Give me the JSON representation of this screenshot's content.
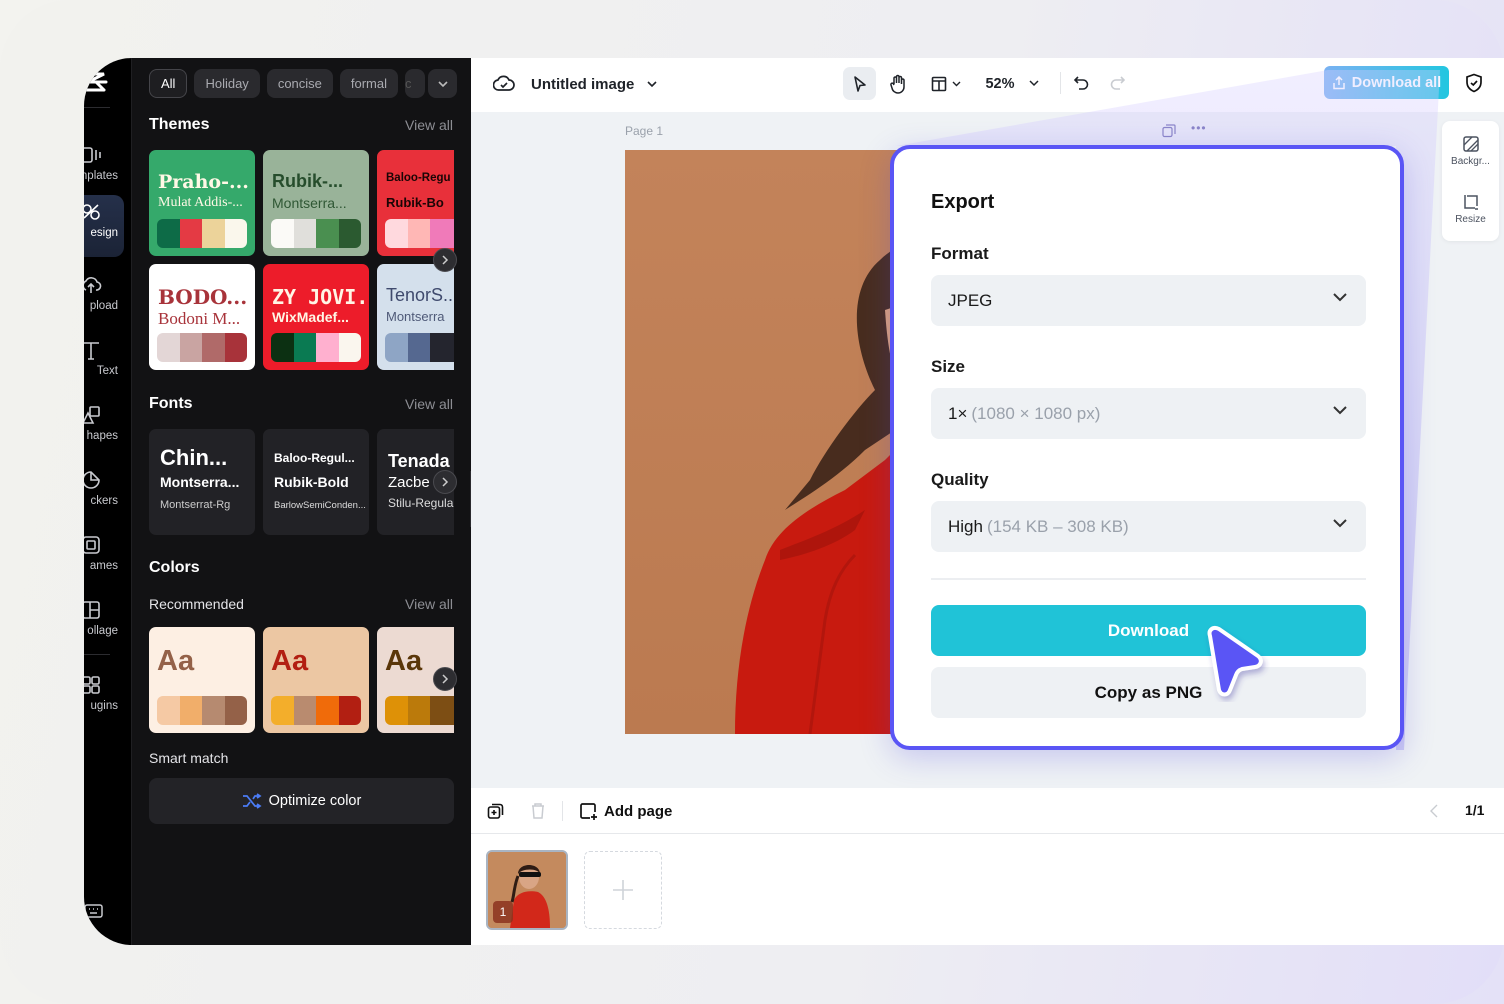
{
  "colors": {
    "accent": "#5a55f5",
    "download_button": "#20c3d7",
    "download_all_gradient": [
      "#7ab1f2",
      "#22c6e0"
    ],
    "panel_bg": "#121214"
  },
  "rail": {
    "items": [
      {
        "label": "Templates",
        "visible_label": "nplates",
        "icon": "templates-icon"
      },
      {
        "label": "Design",
        "visible_label": "esign",
        "icon": "design-icon",
        "active": true
      },
      {
        "label": "Upload",
        "visible_label": "pload",
        "icon": "upload-icon"
      },
      {
        "label": "Text",
        "visible_label": "Text",
        "icon": "text-icon"
      },
      {
        "label": "Shapes",
        "visible_label": "hapes",
        "icon": "shapes-icon"
      },
      {
        "label": "Stickers",
        "visible_label": "ckers",
        "icon": "stickers-icon"
      },
      {
        "label": "Frames",
        "visible_label": "ames",
        "icon": "frames-icon"
      },
      {
        "label": "Collage",
        "visible_label": "ollage",
        "icon": "collage-icon"
      },
      {
        "label": "Plugins",
        "visible_label": "ugins",
        "icon": "plugins-icon"
      }
    ]
  },
  "panel": {
    "chips": [
      "All",
      "Holiday",
      "concise",
      "formal",
      "c"
    ],
    "themes": {
      "title": "Themes",
      "view_all": "View all",
      "cards": [
        {
          "title": "Praho-...",
          "subtitle": "Mulat Addis-...",
          "bg": "#35a96b",
          "fg1": "#fff8e6",
          "fg2": "#fff8e6",
          "swatches": [
            "#0d6b47",
            "#e43a44",
            "#ecd39a",
            "#faf7ec"
          ]
        },
        {
          "title": "Rubik-...",
          "subtitle": "Montserra...",
          "bg": "#99b399",
          "fg1": "#264d2c",
          "fg2": "#2f5734",
          "swatches": [
            "#fbfaf7",
            "#e0dfdb",
            "#4a8f50",
            "#2b5a30"
          ]
        },
        {
          "title": "Baloo-Regu",
          "subtitle": "Rubik-Bo",
          "bg": "#e8303a",
          "fg1": "#1a0505",
          "fg2": "#1a0505",
          "swatches": [
            "#ffd9de",
            "#ffb7b5",
            "#f07ab9",
            "#f07ab9"
          ]
        },
        {
          "title": "BODO...",
          "subtitle": "Bodoni M...",
          "bg": "#ffffff",
          "fg1": "#a8333a",
          "fg2": "#a8333a",
          "swatches": [
            "#e3d6d6",
            "#c9a4a2",
            "#b06a69",
            "#a8333a"
          ]
        },
        {
          "title": "ZY JOVI...",
          "subtitle": "WixMadef...",
          "bg": "#ed1c2a",
          "fg1": "#fff5e5",
          "fg2": "#fff5e5",
          "swatches": [
            "#0c3012",
            "#0a7a52",
            "#ffb0cf",
            "#faf6ee"
          ]
        },
        {
          "title": "TenorS...",
          "subtitle": "Montserra",
          "bg": "#d4e0ec",
          "fg1": "#3f4a6d",
          "fg2": "#4f5a78",
          "swatches": [
            "#8ea5c5",
            "#556890",
            "#24252e",
            "#24252e"
          ]
        }
      ]
    },
    "fonts": {
      "title": "Fonts",
      "view_all": "View all",
      "cards": [
        {
          "line1": "Chin...",
          "line2": "Montserra...",
          "line3": "Montserrat-Rg"
        },
        {
          "line1": "Baloo-Regul...",
          "line2": "Rubik-Bold",
          "line3": "BarlowSemiConden..."
        },
        {
          "line1": "Tenada",
          "line2": "Zacbe",
          "line3": "Stilu-Regula"
        }
      ]
    },
    "colors": {
      "title": "Colors",
      "recommended": "Recommended",
      "view_all": "View all",
      "cards": [
        {
          "label": "Aa",
          "bg": "#fdefe3",
          "fg": "#946148",
          "swatches": [
            "#f5c9a4",
            "#f1ae6a",
            "#b68a70",
            "#946148"
          ]
        },
        {
          "label": "Aa",
          "bg": "#ecc7a3",
          "fg": "#b21f12",
          "swatches": [
            "#f3ae2b",
            "#b98b6f",
            "#f06b0a",
            "#b21f12"
          ]
        },
        {
          "label": "Aa",
          "bg": "#ecdad2",
          "fg": "#5a3609",
          "swatches": [
            "#de9107",
            "#bb7a0b",
            "#7d4e14",
            "#7d4e14"
          ]
        }
      ],
      "smart_match": "Smart match",
      "optimize_label": "Optimize color"
    }
  },
  "topbar": {
    "doc_title": "Untitled image",
    "zoom": "52%",
    "download_all": "Download all"
  },
  "canvas": {
    "page_label": "Page 1"
  },
  "side_tools": [
    {
      "label": "Backgr...",
      "icon": "background-icon"
    },
    {
      "label": "Resize",
      "icon": "resize-icon"
    }
  ],
  "bottombar": {
    "add_page": "Add page",
    "page_indicator": "1/1",
    "thumb_number": "1"
  },
  "export": {
    "title": "Export",
    "format_label": "Format",
    "format_value": "JPEG",
    "size_label": "Size",
    "size_value": "1×",
    "size_detail": "(1080 × 1080 px)",
    "quality_label": "Quality",
    "quality_value": "High",
    "quality_detail": "(154 KB – 308 KB)",
    "download": "Download",
    "copy_png": "Copy as PNG"
  }
}
